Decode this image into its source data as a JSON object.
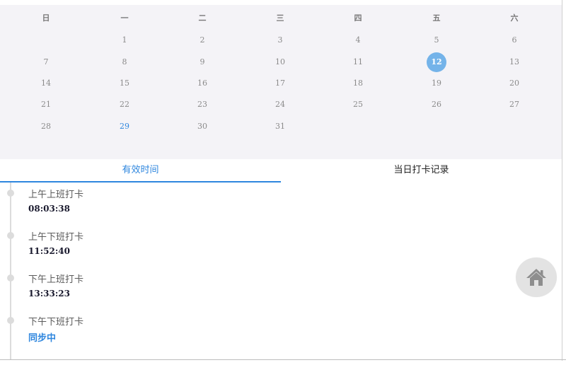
{
  "calendar": {
    "weekdays": [
      "日",
      "一",
      "二",
      "三",
      "四",
      "五",
      "六"
    ],
    "weeks": [
      [
        "",
        "1",
        "2",
        "3",
        "4",
        "5",
        "6"
      ],
      [
        "7",
        "8",
        "9",
        "10",
        "11",
        "12",
        "13"
      ],
      [
        "14",
        "15",
        "16",
        "17",
        "18",
        "19",
        "20"
      ],
      [
        "21",
        "22",
        "23",
        "24",
        "25",
        "26",
        "27"
      ],
      [
        "28",
        "29",
        "30",
        "31",
        "",
        "",
        ""
      ]
    ],
    "selected_day": "12",
    "highlighted_day": "29",
    "colors": {
      "background": "#f4f3f7",
      "selected": "#74b3e9",
      "highlight": "#2e86de"
    }
  },
  "tabs": [
    {
      "label": "有效时间",
      "active": true
    },
    {
      "label": "当日打卡记录",
      "active": false
    }
  ],
  "timeline": [
    {
      "label": "上午上班打卡",
      "time": "08:03:38"
    },
    {
      "label": "上午下班打卡",
      "time": "11:52:40"
    },
    {
      "label": "下午上班打卡",
      "time": "13:33:23"
    },
    {
      "label": "下午下班打卡",
      "time": "同步中"
    }
  ],
  "home_button": {
    "icon": "home-icon"
  },
  "colors": {
    "accent": "#2e86de"
  }
}
